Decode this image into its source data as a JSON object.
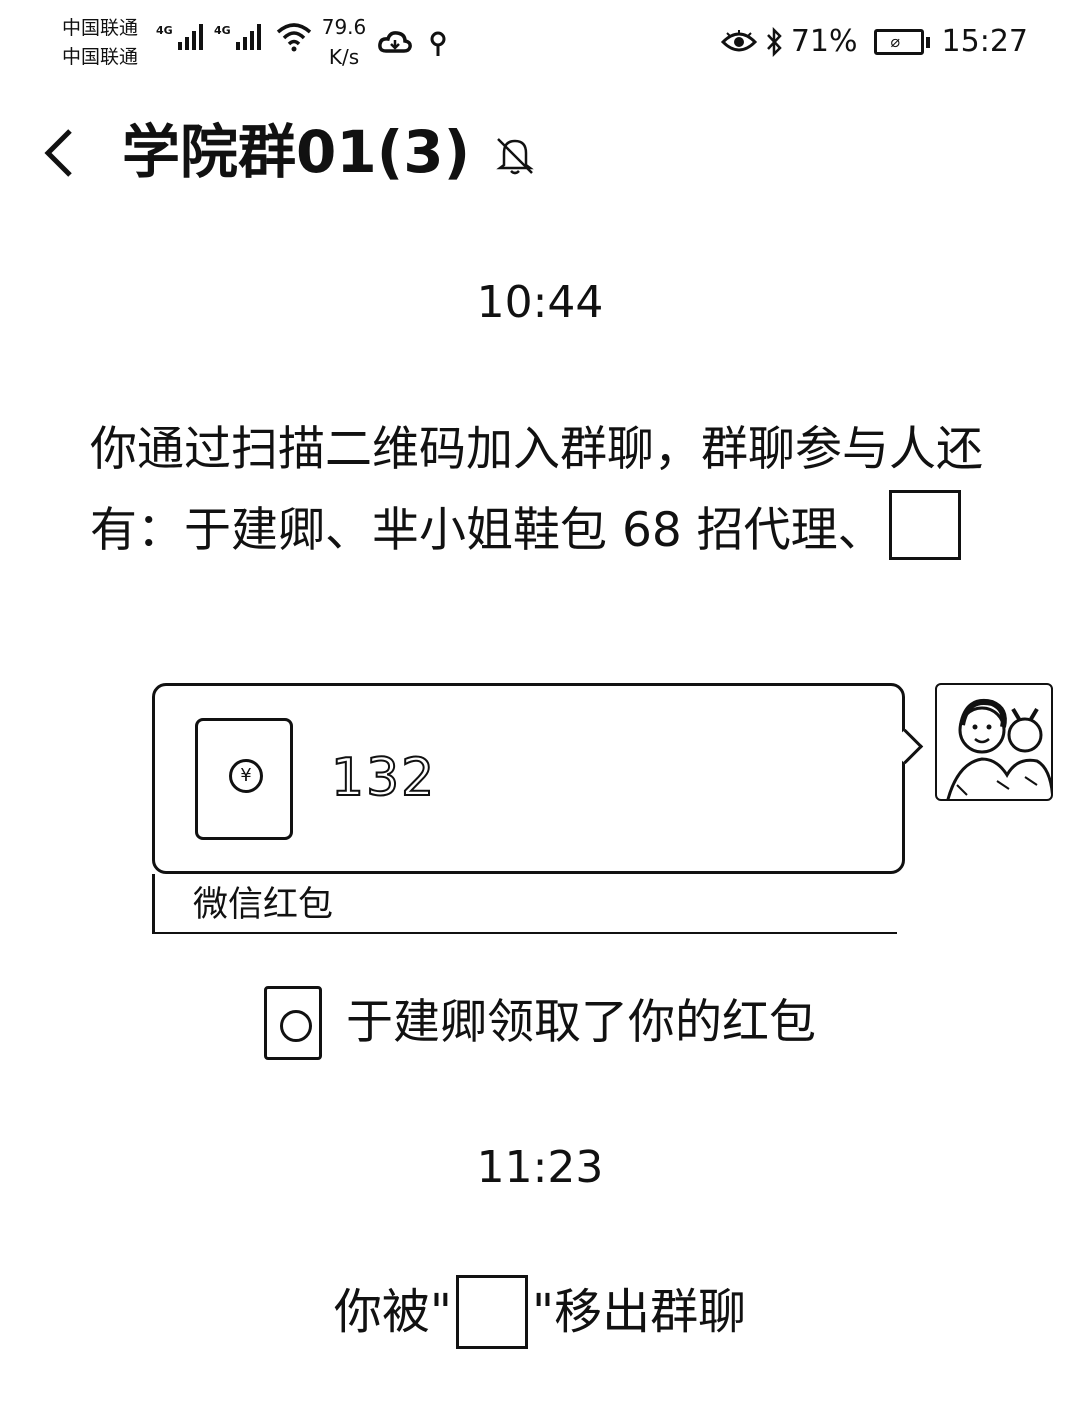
{
  "status_bar": {
    "carrier_1": "中国联通",
    "carrier_2": "中国联通",
    "network_1": "4G",
    "network_2": "4G",
    "net_speed_value": "79.6",
    "net_speed_unit": "K/s",
    "battery_percent": "71%",
    "time": "15:27",
    "icons": [
      "signal-icon",
      "wifi-icon",
      "cloud-icon",
      "location-icon",
      "eye-icon",
      "bluetooth-icon",
      "battery-icon"
    ]
  },
  "header": {
    "title": "学院群01(3)",
    "back_icon": "chevron-left-icon",
    "mute_icon": "bell-muted-icon"
  },
  "messages": {
    "time_1": "10:44",
    "system_join": "你通过扫描二维码加入群聊，群聊参与人还有：于建卿、芈小姐鞋包 68 招代理、",
    "red_packet": {
      "amount_text": "132",
      "footer_label": "微信红包"
    },
    "packet_claimed": "于建卿领取了你的红包",
    "time_2": "11:23",
    "removed_prefix": "你被\"",
    "removed_suffix": "\"移出群聊"
  },
  "colors": {
    "background": "#ffffff",
    "foreground": "#111111"
  }
}
